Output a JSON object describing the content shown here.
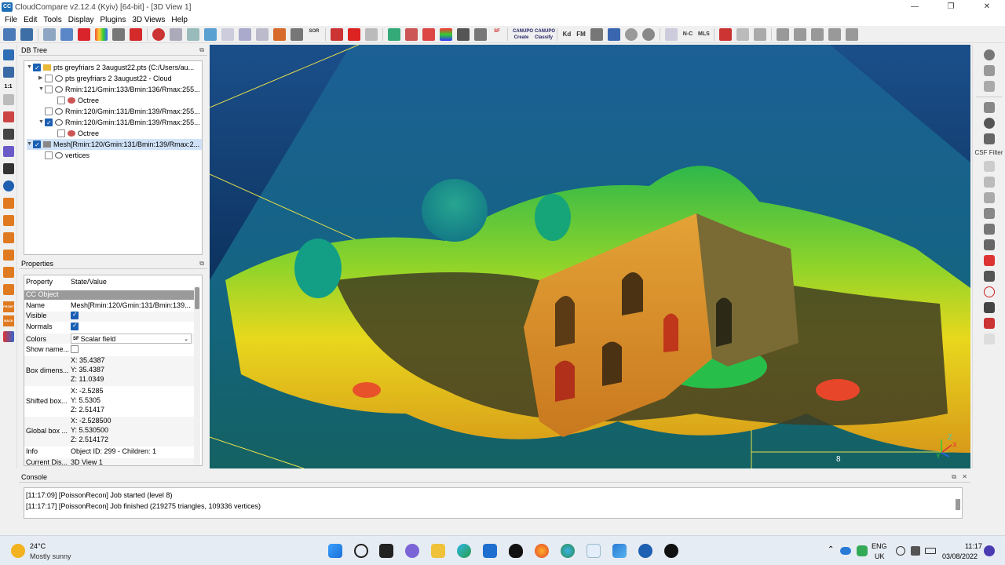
{
  "window": {
    "title": "CloudCompare v2.12.4 (Kyiv) [64-bit] - [3D View 1]",
    "app_icon_label": "CC",
    "controls": [
      "—",
      "❐",
      "✕"
    ]
  },
  "menu": [
    "File",
    "Edit",
    "Tools",
    "Display",
    "Plugins",
    "3D Views",
    "Help"
  ],
  "toolbar": {
    "text_buttons": {
      "sor": "SOR",
      "sf": "SF",
      "cs_create": "CANUPO Create",
      "cs_classify": "CANUPO Classify",
      "kd": "Kd",
      "fm": "FM",
      "nc": "N-C",
      "mls": "MLS"
    }
  },
  "db_tree": {
    "title": "DB Tree",
    "items": [
      {
        "label": "pts greyfriars 2 3august22.pts (C:/Users/au..."
      },
      {
        "label": "pts greyfriars 2 3august22 - Cloud"
      },
      {
        "label": "Rmin:121/Gmin:133/Bmin:136/Rmax:255..."
      },
      {
        "label": "Octree"
      },
      {
        "label": "Rmin:120/Gmin:131/Bmin:139/Rmax:255..."
      },
      {
        "label": "Rmin:120/Gmin:131/Bmin:139/Rmax:255..."
      },
      {
        "label": "Octree"
      },
      {
        "label": "Mesh[Rmin:120/Gmin:131/Bmin:139/Rmax:2..."
      },
      {
        "label": "vertices"
      }
    ]
  },
  "properties": {
    "title": "Properties",
    "col_property": "Property",
    "col_value": "State/Value",
    "section": "CC Object",
    "rows": [
      {
        "key": "Name",
        "value": "Mesh[Rmin:120/Gmin:131/Bmin:139..."
      },
      {
        "key": "Visible",
        "value": ""
      },
      {
        "key": "Normals",
        "value": ""
      },
      {
        "key": "Colors",
        "value": "Scalar field"
      },
      {
        "key": "Show name...",
        "value": ""
      },
      {
        "key": "Box dimens...",
        "values": [
          "X: 35.4387",
          "Y: 35.4387",
          "Z: 11.0349"
        ]
      },
      {
        "key": "Shifted box...",
        "values": [
          "X: -2.5285",
          "Y: 5.5305",
          "Z: 2.51417"
        ]
      },
      {
        "key": "Global box ...",
        "values": [
          "X: -2.528500",
          "Y: 5.530500",
          "Z: 2.514172"
        ]
      },
      {
        "key": "Info",
        "value": "Object ID: 299 - Children: 1"
      },
      {
        "key": "Current Dis...",
        "value": "3D View 1"
      }
    ],
    "sf_badge": "SF"
  },
  "view3d": {
    "scale_label": "8",
    "axis": {
      "x": "X",
      "y": "Y",
      "z": "Z"
    }
  },
  "right_toolbar": {
    "csf_label": "CSF Filter"
  },
  "left_toolbar": {
    "front_label": "FRONT",
    "back_label": "BACK",
    "scale_11": "1:1"
  },
  "console": {
    "title": "Console",
    "lines": [
      "[11:17:09] [PoissonRecon] Job started (level 8)",
      "[11:17:17] [PoissonRecon] Job finished (219275 triangles, 109336 vertices)"
    ]
  },
  "taskbar": {
    "weather_temp": "24°C",
    "weather_desc": "Mostly sunny",
    "lang_top": "ENG",
    "lang_bottom": "UK",
    "time": "11:17",
    "date": "03/08/2022"
  }
}
